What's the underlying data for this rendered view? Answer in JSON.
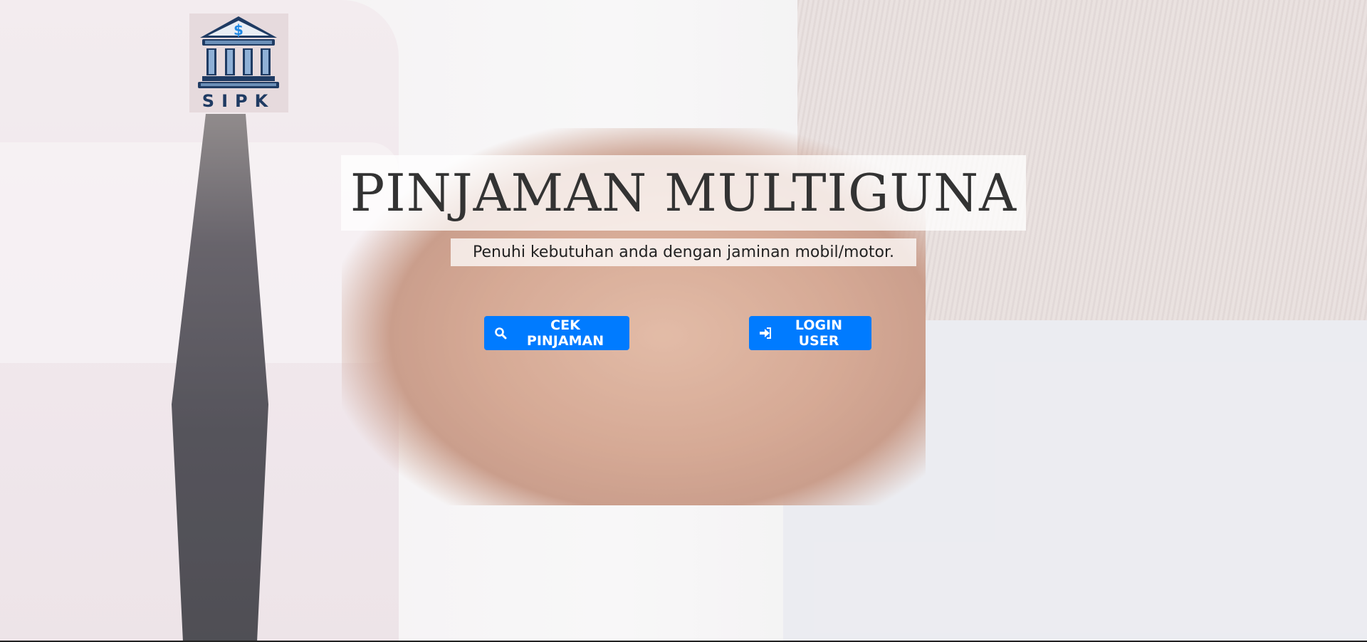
{
  "logo": {
    "text": "SIPK",
    "currency_symbol": "$",
    "icon": "bank-building-icon",
    "colors": {
      "navy": "#1f3b63",
      "steel": "#6b8fb8",
      "dollar": "#1e88e5"
    }
  },
  "hero": {
    "title": "PINJAMAN MULTIGUNA",
    "subtitle": "Penuhi kebutuhan anda dengan jaminan mobil/motor."
  },
  "buttons": {
    "cek": {
      "label": "CEK PINJAMAN",
      "icon": "search-icon"
    },
    "login": {
      "label": "LOGIN USER",
      "icon": "sign-in-icon"
    }
  },
  "colors": {
    "button": "#007bff",
    "button_text": "#ffffff",
    "title_text": "#333333"
  }
}
